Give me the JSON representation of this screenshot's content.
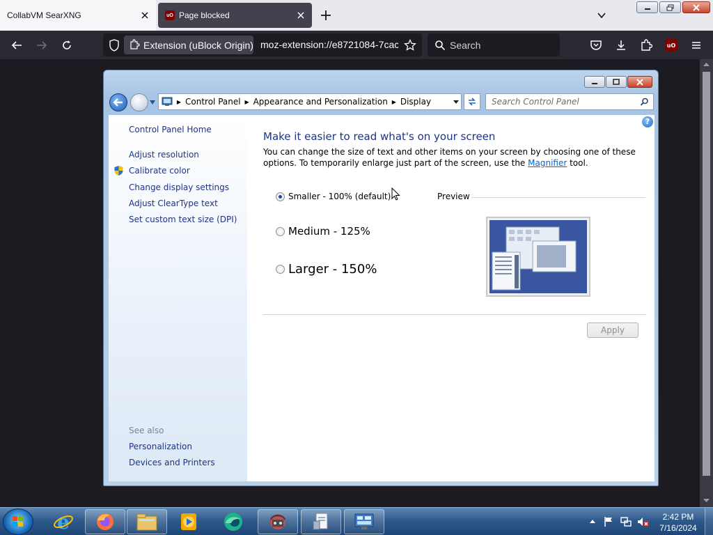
{
  "browser": {
    "tabs": [
      {
        "label": "CollabVM SearXNG",
        "active": false
      },
      {
        "label": "Page blocked",
        "active": true
      }
    ],
    "identity_label": "Extension (uBlock Origin)",
    "url": "moz-extension://e8721084-7cac",
    "search_placeholder": "Search",
    "accent": "#2b2a33"
  },
  "control_panel": {
    "breadcrumb": [
      "Control Panel",
      "Appearance and Personalization",
      "Display"
    ],
    "search_placeholder": "Search Control Panel",
    "sidebar": {
      "home": "Control Panel Home",
      "links": [
        "Adjust resolution",
        "Calibrate color",
        "Change display settings",
        "Adjust ClearType text",
        "Set custom text size (DPI)"
      ],
      "see_also_heading": "See also",
      "see_also": [
        "Personalization",
        "Devices and Printers"
      ]
    },
    "main": {
      "title": "Make it easier to read what's on your screen",
      "desc_part1": "You can change the size of text and other items on your screen by choosing one of these options. To temporarily enlarge just part of the screen, use the ",
      "desc_link": "Magnifier",
      "desc_part2": " tool.",
      "options": [
        {
          "label": "Smaller - 100% (default)",
          "checked": true
        },
        {
          "label": "Medium - 125%",
          "checked": false
        },
        {
          "label": "Larger - 150%",
          "checked": false
        }
      ],
      "preview_label": "Preview",
      "apply_label": "Apply"
    }
  },
  "taskbar": {
    "items": [
      "internet-explorer-icon",
      "firefox-icon",
      "file-explorer-icon",
      "media-player-icon",
      "edge-like-icon",
      "network-icon",
      "document-icon",
      "control-panel-icon"
    ],
    "time": "2:42 PM",
    "date": "7/16/2024"
  }
}
